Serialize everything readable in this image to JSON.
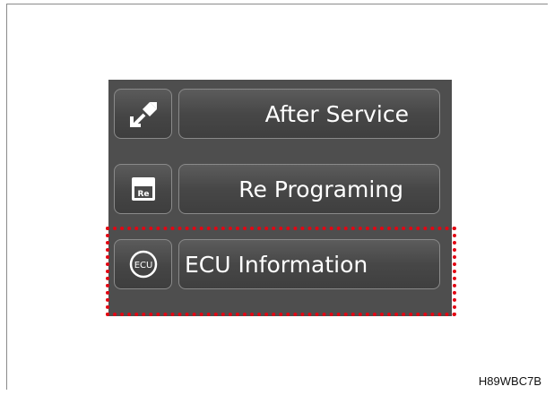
{
  "menu": {
    "items": [
      {
        "label": "After Service",
        "icon": "wrench-arrow-icon"
      },
      {
        "label": "Re Programing",
        "icon": "reprogram-window-icon",
        "icon_text": "Re"
      },
      {
        "label": "ECU Information",
        "icon": "ecu-circle-icon",
        "icon_text": "ECU"
      }
    ],
    "highlighted_item": "ECU Information"
  },
  "figure_code": "H89WBC7B",
  "colors": {
    "panel_bg": "#4e4e4e",
    "button_border": "#8a8a8a",
    "button_text": "#ffffff",
    "highlight": "#e30613"
  }
}
